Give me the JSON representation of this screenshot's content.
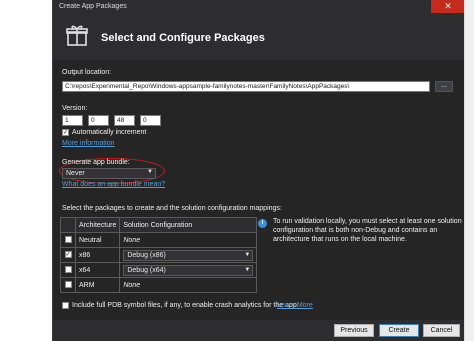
{
  "window": {
    "title": "Create App Packages",
    "close_glyph": "✕"
  },
  "header": {
    "title": "Select and Configure Packages",
    "icon": "package-icon"
  },
  "output": {
    "label": "Output location:",
    "value": "C:\\repos\\Experimental_Repo\\Windows-appsample-familynotes-master\\FamilyNotes\\AppPackages\\",
    "browse_label": "..."
  },
  "version": {
    "label": "Version:",
    "major": "1",
    "minor": "0",
    "build": "48",
    "revision": "0",
    "auto_increment_label": "Automatically increment",
    "auto_increment_checked": true,
    "more_info_link": "More information"
  },
  "bundle": {
    "label": "Generate app bundle:",
    "selected": "Never",
    "link": "What does an app bundle mean?"
  },
  "mappings": {
    "instruction": "Select the packages to create and the solution configuration mappings:",
    "columns": [
      "Architecture",
      "Solution Configuration"
    ],
    "rows": [
      {
        "checked": false,
        "arch": "Neutral",
        "config": "None",
        "dropdown": false
      },
      {
        "checked": true,
        "arch": "x86",
        "config": "Debug (x86)",
        "dropdown": true
      },
      {
        "checked": false,
        "arch": "x64",
        "config": "Debug (x64)",
        "dropdown": true
      },
      {
        "checked": false,
        "arch": "ARM",
        "config": "None",
        "dropdown": false
      }
    ]
  },
  "info": {
    "icon": "info-icon",
    "text": "To run validation locally, you must select at least one solution configuration that is both non-Debug and contains an architecture that runs on the local machine."
  },
  "pdb": {
    "label": "Include full PDB symbol files, if any, to enable crash analytics for the app.",
    "link": "Learn More",
    "checked": false
  },
  "buttons": {
    "previous": "Previous",
    "create": "Create",
    "cancel": "Cancel"
  },
  "colors": {
    "accent_link": "#569cd6",
    "highlight_ring": "#d0181e",
    "close_button": "#c42b1c"
  }
}
